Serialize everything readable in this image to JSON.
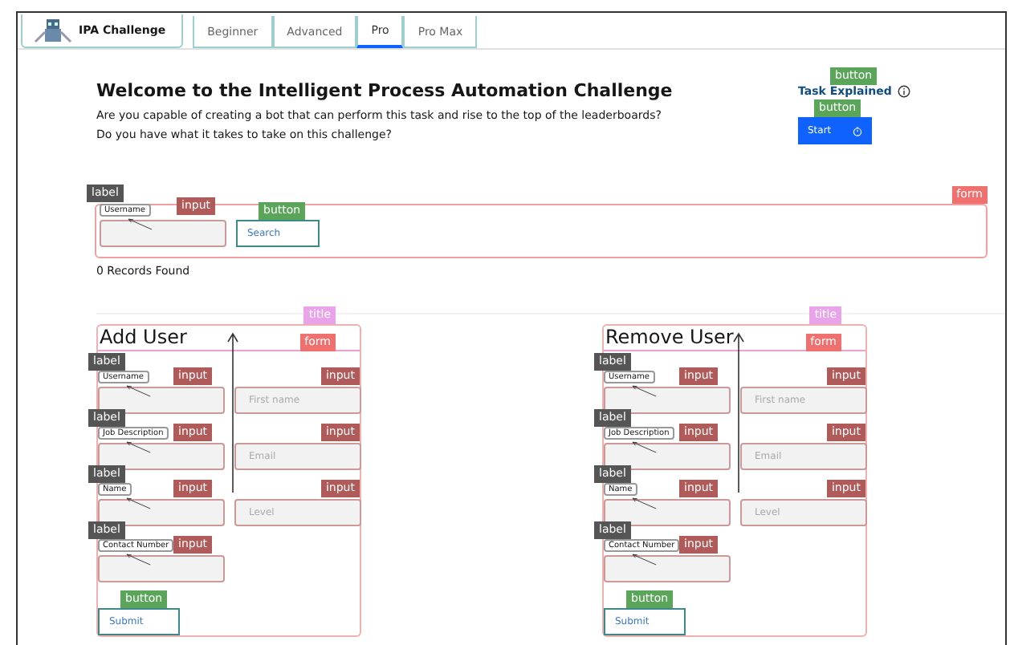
{
  "header": {
    "logo_text": "IPA Challenge",
    "tabs": [
      {
        "label": "Beginner",
        "selected": false
      },
      {
        "label": "Advanced",
        "selected": false
      },
      {
        "label": "Pro",
        "selected": true
      },
      {
        "label": "Pro Max",
        "selected": false
      }
    ]
  },
  "intro": {
    "title": "Welcome to the Intelligent Process Automation Challenge",
    "lines": [
      "Are you capable of creating a bot that can perform this task and rise to the top of the leaderboards?",
      "Do you have what it takes to take on this challenge?"
    ]
  },
  "actions": {
    "link": "Task Explained",
    "link_tag": "button",
    "start": "Start",
    "start_tag": "button"
  },
  "search_form": {
    "tag": "form",
    "label": "Username",
    "label_tag": "label",
    "input_tag": "input",
    "button": "Search",
    "button_tag": "button"
  },
  "records": "0 Records Found",
  "panels": [
    {
      "title": "Add User",
      "title_tag": "title",
      "form_tag": "form",
      "left_fields": [
        {
          "label": "Username",
          "label_tag": "label",
          "input_tag": "input"
        },
        {
          "label": "Job Description",
          "label_tag": "label",
          "input_tag": "input"
        },
        {
          "label": "Name",
          "label_tag": "label",
          "input_tag": "input"
        },
        {
          "label": "Contact Number",
          "label_tag": "label",
          "input_tag": "input"
        }
      ],
      "right_fields": [
        {
          "placeholder": "First name",
          "input_tag": "input"
        },
        {
          "placeholder": "Email",
          "input_tag": "input"
        },
        {
          "placeholder": "Level",
          "input_tag": "input"
        }
      ],
      "submit": "Submit",
      "submit_tag": "button"
    },
    {
      "title": "Remove User",
      "title_tag": "title",
      "form_tag": "form",
      "left_fields": [
        {
          "label": "Username",
          "label_tag": "label",
          "input_tag": "input"
        },
        {
          "label": "Job Description",
          "label_tag": "label",
          "input_tag": "input"
        },
        {
          "label": "Name",
          "label_tag": "label",
          "input_tag": "input"
        },
        {
          "label": "Contact Number",
          "label_tag": "label",
          "input_tag": "input"
        }
      ],
      "right_fields": [
        {
          "placeholder": "First name",
          "input_tag": "input"
        },
        {
          "placeholder": "Email",
          "input_tag": "input"
        },
        {
          "placeholder": "Level",
          "input_tag": "input"
        }
      ],
      "submit": "Submit",
      "submit_tag": "button"
    }
  ]
}
